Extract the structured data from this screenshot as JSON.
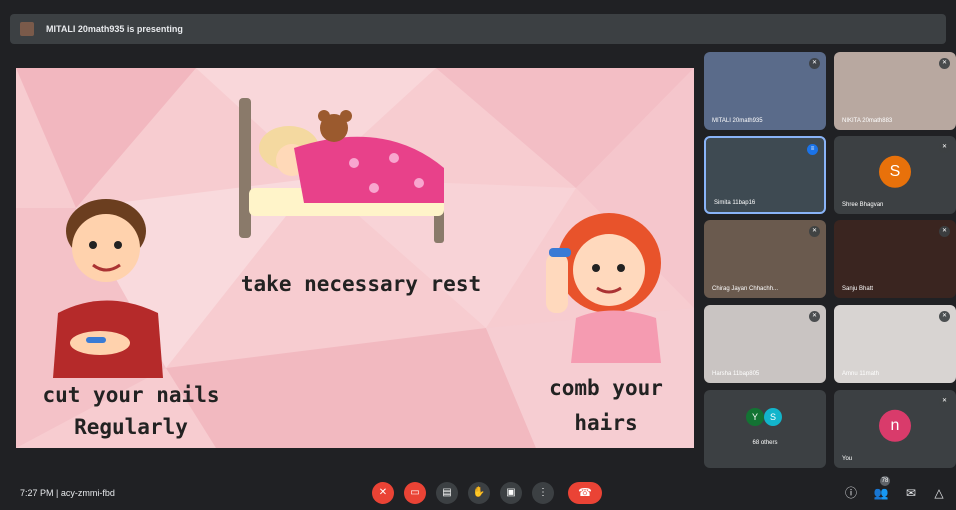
{
  "presenter": {
    "text": "MITALI 20math935 is presenting"
  },
  "slide": {
    "captions": {
      "rest": "take necessary rest",
      "nails_1": "cut your nails",
      "nails_2": "Regularly",
      "comb_1": "comb your",
      "comb_2": "hairs"
    },
    "colors": {
      "background": "#f6c9cd",
      "blanket": "#e8418a"
    }
  },
  "participants": [
    {
      "name": "MITALI 20math935",
      "mic": "mic-off-icon"
    },
    {
      "name": "NIKITA 20math883",
      "mic": "mic-off-icon"
    },
    {
      "name": "Simita 11bap16",
      "mic": "speaking-icon"
    },
    {
      "name": "Shree Bhagvan",
      "letter": "S",
      "color": "#e8710a"
    },
    {
      "name": "Chirag Jayan Chhachh...",
      "mic": "mic-off-icon"
    },
    {
      "name": "Sanju Bhatt",
      "mic": "mic-off-icon"
    },
    {
      "name": "Harsha 11bap805",
      "mic": "mic-off-icon"
    },
    {
      "name": "Amnu 11math",
      "mic": "mic-off-icon"
    },
    {
      "name": "68 others",
      "letters": [
        "Y",
        "S"
      ]
    },
    {
      "name": "You",
      "letter": "n",
      "color": "#d93b6b"
    }
  ],
  "meeting": {
    "time": "7:27 PM",
    "separator": "|",
    "code": "acy-zmmi-fbd"
  },
  "toolbar": {
    "people_count": "78"
  }
}
